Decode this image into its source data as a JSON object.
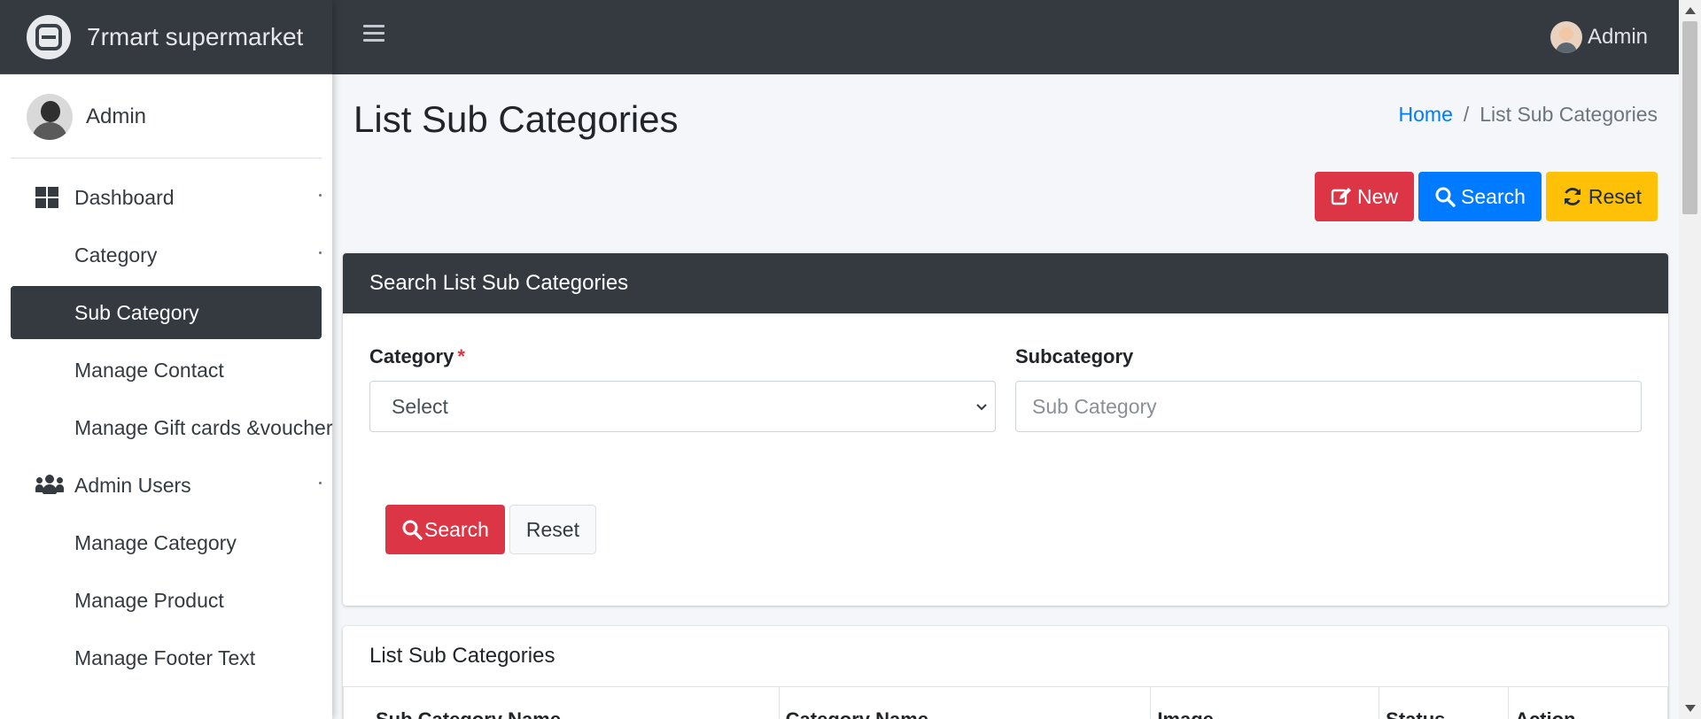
{
  "brand": {
    "name": "7rmart supermarket",
    "icon": "brand-logo-icon"
  },
  "topbar": {
    "menu_icon": "hamburger-menu-icon",
    "user_name": "Admin"
  },
  "sidebar": {
    "user_name": "Admin",
    "items": [
      {
        "label": "Dashboard",
        "icon": "dashboard-grid-icon",
        "has_caret": true,
        "active": false
      },
      {
        "label": "Category",
        "icon": "",
        "has_caret": true,
        "active": false
      },
      {
        "label": "Sub Category",
        "icon": "",
        "has_caret": false,
        "active": true
      },
      {
        "label": "Manage Contact",
        "icon": "",
        "has_caret": false,
        "active": false
      },
      {
        "label": "Manage Gift cards &voucher",
        "icon": "",
        "has_caret": false,
        "active": false
      },
      {
        "label": "Admin Users",
        "icon": "users-icon",
        "has_caret": true,
        "active": false
      },
      {
        "label": "Manage Category",
        "icon": "",
        "has_caret": false,
        "active": false
      },
      {
        "label": "Manage Product",
        "icon": "",
        "has_caret": false,
        "active": false
      },
      {
        "label": "Manage Footer Text",
        "icon": "",
        "has_caret": false,
        "active": false
      }
    ]
  },
  "page": {
    "title": "List Sub Categories",
    "breadcrumb": {
      "home": "Home",
      "separator": "/",
      "current": "List Sub Categories"
    }
  },
  "actions": {
    "new_label": "New",
    "search_label": "Search",
    "reset_label": "Reset"
  },
  "search_card": {
    "header": "Search List Sub Categories",
    "category_label": "Category",
    "required_mark": "*",
    "category_value": "Select",
    "subcategory_label": "Subcategory",
    "subcategory_placeholder": "Sub Category",
    "search_button": "Search",
    "reset_button": "Reset"
  },
  "list_card": {
    "title": "List Sub Categories",
    "columns": [
      "Sub Category Name",
      "Category Name",
      "Image",
      "Status",
      "Action"
    ]
  },
  "colors": {
    "dark": "#343a40",
    "primary": "#007bff",
    "danger": "#dc3545",
    "warning": "#ffc107",
    "background": "#f4f6f9"
  }
}
